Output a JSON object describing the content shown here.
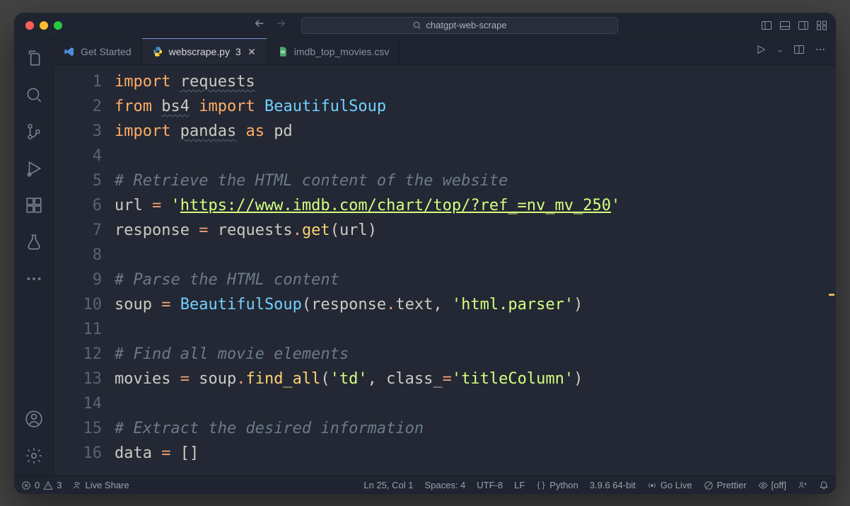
{
  "window": {
    "project_name": "chatgpt-web-scrape"
  },
  "tabs": {
    "get_started": {
      "label": "Get Started"
    },
    "webscrape": {
      "label": "webscrape.py",
      "problems": "3"
    },
    "csv": {
      "label": "imdb_top_movies.csv"
    }
  },
  "code_lines": [
    {
      "n": "1",
      "segments": [
        {
          "t": "import ",
          "c": "kw"
        },
        {
          "t": "requests",
          "c": "mod"
        }
      ]
    },
    {
      "n": "2",
      "segments": [
        {
          "t": "from ",
          "c": "kw"
        },
        {
          "t": "bs4",
          "c": "mod"
        },
        {
          "t": " import ",
          "c": "kw"
        },
        {
          "t": "BeautifulSoup",
          "c": "cls"
        }
      ]
    },
    {
      "n": "3",
      "segments": [
        {
          "t": "import ",
          "c": "kw"
        },
        {
          "t": "pandas",
          "c": "mod"
        },
        {
          "t": " as ",
          "c": "kw"
        },
        {
          "t": "pd",
          "c": "var"
        }
      ]
    },
    {
      "n": "4",
      "segments": []
    },
    {
      "n": "5",
      "segments": [
        {
          "t": "# Retrieve the HTML content of the website",
          "c": "com"
        }
      ]
    },
    {
      "n": "6",
      "segments": [
        {
          "t": "url ",
          "c": "var"
        },
        {
          "t": "=",
          "c": "op"
        },
        {
          "t": " '",
          "c": "str"
        },
        {
          "t": "https://www.imdb.com/chart/top/?ref_=nv_mv_250",
          "c": "str url"
        },
        {
          "t": "'",
          "c": "str"
        }
      ]
    },
    {
      "n": "7",
      "segments": [
        {
          "t": "response ",
          "c": "var"
        },
        {
          "t": "=",
          "c": "op"
        },
        {
          "t": " requests",
          "c": "var"
        },
        {
          "t": ".",
          "c": "op"
        },
        {
          "t": "get",
          "c": "fn"
        },
        {
          "t": "(",
          "c": "paren"
        },
        {
          "t": "url",
          "c": "var"
        },
        {
          "t": ")",
          "c": "paren"
        }
      ]
    },
    {
      "n": "8",
      "segments": []
    },
    {
      "n": "9",
      "segments": [
        {
          "t": "# Parse the HTML content",
          "c": "com"
        }
      ]
    },
    {
      "n": "10",
      "segments": [
        {
          "t": "soup ",
          "c": "var"
        },
        {
          "t": "=",
          "c": "op"
        },
        {
          "t": " ",
          "c": "var"
        },
        {
          "t": "BeautifulSoup",
          "c": "cls"
        },
        {
          "t": "(",
          "c": "paren"
        },
        {
          "t": "response",
          "c": "var"
        },
        {
          "t": ".",
          "c": "op"
        },
        {
          "t": "text",
          "c": "var"
        },
        {
          "t": ", ",
          "c": "var"
        },
        {
          "t": "'html.parser'",
          "c": "str"
        },
        {
          "t": ")",
          "c": "paren"
        }
      ]
    },
    {
      "n": "11",
      "segments": []
    },
    {
      "n": "12",
      "segments": [
        {
          "t": "# Find all movie elements",
          "c": "com"
        }
      ]
    },
    {
      "n": "13",
      "segments": [
        {
          "t": "movies ",
          "c": "var"
        },
        {
          "t": "=",
          "c": "op"
        },
        {
          "t": " soup",
          "c": "var"
        },
        {
          "t": ".",
          "c": "op"
        },
        {
          "t": "find_all",
          "c": "fn"
        },
        {
          "t": "(",
          "c": "paren"
        },
        {
          "t": "'td'",
          "c": "str"
        },
        {
          "t": ", ",
          "c": "var"
        },
        {
          "t": "class_",
          "c": "var"
        },
        {
          "t": "=",
          "c": "op"
        },
        {
          "t": "'titleColumn'",
          "c": "str"
        },
        {
          "t": ")",
          "c": "paren"
        }
      ]
    },
    {
      "n": "14",
      "segments": []
    },
    {
      "n": "15",
      "segments": [
        {
          "t": "# Extract the desired information",
          "c": "com"
        }
      ]
    },
    {
      "n": "16",
      "segments": [
        {
          "t": "data ",
          "c": "var"
        },
        {
          "t": "=",
          "c": "op"
        },
        {
          "t": " ",
          "c": "var"
        },
        {
          "t": "[]",
          "c": "paren"
        }
      ]
    }
  ],
  "status": {
    "errors": "0",
    "warnings": "3",
    "live_share": "Live Share",
    "ln_col": "Ln 25, Col 1",
    "spaces": "Spaces: 4",
    "encoding": "UTF-8",
    "eol": "LF",
    "language": "Python",
    "interpreter": "3.9.6 64-bit",
    "go_live": "Go Live",
    "prettier": "Prettier",
    "off": "[off]"
  }
}
